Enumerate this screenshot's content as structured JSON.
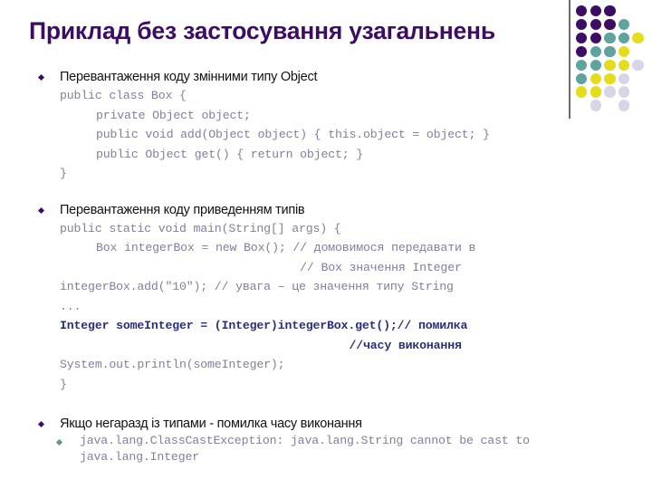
{
  "slide": {
    "title": "Приклад без застосування узагальнень",
    "title_color": "#3d0c63"
  },
  "decor": {
    "divider_color": "#6b6b6b",
    "palette": {
      "purple": "#3d0c63",
      "teal": "#5fa3a0",
      "yellow": "#e3dd1e",
      "lavender": "#d6d6e6"
    },
    "dot_grid": [
      [
        "purple",
        "purple",
        "purple",
        null,
        null
      ],
      [
        "purple",
        "purple",
        "purple",
        "teal",
        null
      ],
      [
        "purple",
        "purple",
        "teal",
        "teal",
        "yellow"
      ],
      [
        "purple",
        "teal",
        "teal",
        "yellow",
        null
      ],
      [
        "teal",
        "teal",
        "yellow",
        "yellow",
        "lavender"
      ],
      [
        "teal",
        "yellow",
        "yellow",
        "lavender",
        null
      ],
      [
        "yellow",
        "yellow",
        "lavender",
        "lavender",
        null
      ],
      [
        null,
        "lavender",
        null,
        "lavender",
        null
      ]
    ]
  },
  "content": {
    "bullet1": {
      "heading": "Перевантаження коду змінними типу Object",
      "code": [
        {
          "text": "public class Box {",
          "indent": 0,
          "bold": false
        },
        {
          "text": "private Object object;",
          "indent": 1,
          "bold": false
        },
        {
          "text": "public void add(Object object) { this.object = object; }",
          "indent": 1,
          "bold": false
        },
        {
          "text": "public Object get() { return object; }",
          "indent": 1,
          "bold": false
        },
        {
          "text": "}",
          "indent": 0,
          "bold": false
        }
      ]
    },
    "bullet2": {
      "heading": "Перевантаження коду приведенням типів",
      "code": [
        {
          "text": "public static void main(String[] args) {",
          "indent": 0,
          "bold": false
        },
        {
          "text": "Box integerBox = new Box(); // домовимося передавати в",
          "indent": 1,
          "bold": false
        },
        {
          "text": "                             // Box значення Integer",
          "indent": 1,
          "bold": false
        },
        {
          "text": "integerBox.add(\"10\"); // увага – це значення типу String",
          "indent": 0,
          "bold": false
        },
        {
          "text": "...",
          "indent": 0,
          "bold": false
        },
        {
          "text": "Integer someInteger = (Integer)integerBox.get();// помилка",
          "indent": 0,
          "bold": true
        },
        {
          "text": "                                    //часу виконання",
          "indent": 1,
          "bold": true
        },
        {
          "text": "System.out.println(someInteger);",
          "indent": 0,
          "bold": false
        },
        {
          "text": "}",
          "indent": 0,
          "bold": false
        }
      ]
    },
    "bullet3": {
      "heading": "Якщо негаразд із типами - помилка часу виконання",
      "subitem": "java.lang.ClassCastException: java.lang.String cannot be cast to java.lang.Integer"
    }
  }
}
